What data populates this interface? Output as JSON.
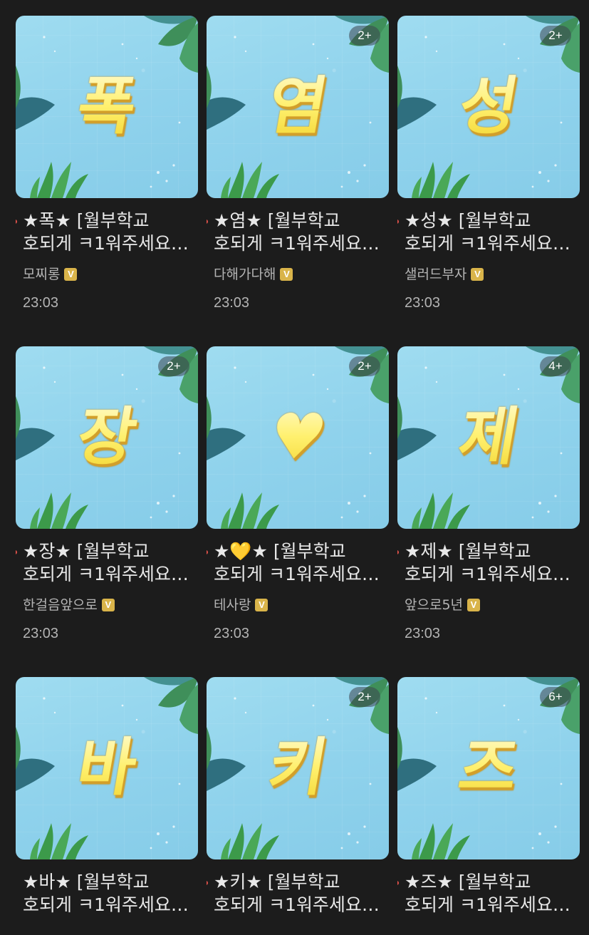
{
  "posts": [
    {
      "glyph": "폭",
      "badge": "",
      "title_line1": "★폭★ [월부학교",
      "title_line2": "호되게 ㅋ1워주세요…",
      "author": "모찌롱",
      "verified": "V",
      "time": "23:03",
      "unread": true
    },
    {
      "glyph": "염",
      "badge": "2+",
      "title_line1": "★염★ [월부학교",
      "title_line2": "호되게 ㅋ1워주세요…",
      "author": "다해가다해",
      "verified": "V",
      "time": "23:03",
      "unread": true
    },
    {
      "glyph": "성",
      "badge": "2+",
      "title_line1": "★성★ [월부학교",
      "title_line2": "호되게 ㅋ1워주세요…",
      "author": "샐러드부자",
      "verified": "V",
      "time": "23:03",
      "unread": true
    },
    {
      "glyph": "장",
      "badge": "2+",
      "title_line1": "★장★ [월부학교",
      "title_line2": "호되게 ㅋ1워주세요…",
      "author": "한걸음앞으로",
      "verified": "V",
      "time": "23:03",
      "unread": true
    },
    {
      "glyph": "♥",
      "badge": "2+",
      "title_line1": "★💛★ [월부학교",
      "title_line2": "호되게 ㅋ1워주세요…",
      "author": "테사랑",
      "verified": "V",
      "time": "23:03",
      "unread": true
    },
    {
      "glyph": "제",
      "badge": "4+",
      "title_line1": "★제★ [월부학교",
      "title_line2": "호되게 ㅋ1워주세요…",
      "author": "앞으로5년",
      "verified": "V",
      "time": "23:03",
      "unread": true
    },
    {
      "glyph": "바",
      "badge": "",
      "title_line1": "★바★ [월부학교",
      "title_line2": "호되게 ㅋ1워주세요…",
      "author": "",
      "verified": "",
      "time": "",
      "unread": false
    },
    {
      "glyph": "키",
      "badge": "2+",
      "title_line1": "★키★ [월부학교",
      "title_line2": "호되게 ㅋ1워주세요…",
      "author": "",
      "verified": "",
      "time": "",
      "unread": true
    },
    {
      "glyph": "즈",
      "badge": "6+",
      "title_line1": "★즈★ [월부학교",
      "title_line2": "호되게 ㅋ1워주세요…",
      "author": "",
      "verified": "",
      "time": "",
      "unread": true
    }
  ],
  "colors": {
    "background": "#1c1c1c",
    "thumb_bg": "#8fd2ec",
    "glyph_yellow": "#fff06e",
    "unread_dot": "#e0524a",
    "verified_badge": "#d9b44a"
  }
}
